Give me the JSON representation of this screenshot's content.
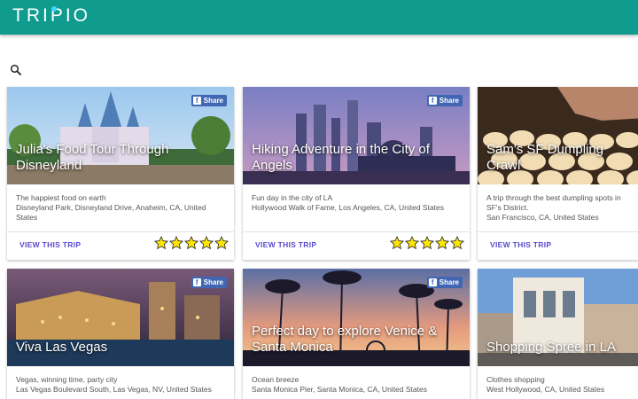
{
  "header": {
    "logo": "TRIPIO",
    "brand_color": "#0f9b8d"
  },
  "search": {
    "icon": "search-icon"
  },
  "share_label": "Share",
  "cards": [
    {
      "title": "Julia's Food Tour Through Disneyland",
      "description": "The happiest food on earth",
      "location": "Disneyland Park, Disneyland Drive, Anaheim, CA, United States",
      "link": "VIEW THIS TRIP",
      "rating": 5,
      "share": true
    },
    {
      "title": "Hiking Adventure in the City of Angels",
      "description": "Fun day in the city of LA",
      "location": "Hollywood Walk of Fame, Los Angeles, CA, United States",
      "link": "VIEW THIS TRIP",
      "rating": 5,
      "share": true
    },
    {
      "title": "Sam's SF Dumpling Crawl",
      "description": "A trip through the best dumpling spots in SF's District.",
      "location": "San Francisco, CA, United States",
      "link": "VIEW THIS TRIP",
      "rating": 0,
      "share": false
    },
    {
      "title": "Viva Las Vegas",
      "description": "Vegas, winning time, party city",
      "location": "Las Vegas Boulevard South, Las Vegas, NV, United States",
      "share": true
    },
    {
      "title": "Perfect day to explore Venice & Santa Monica",
      "description": "Ocean breeze",
      "location": "Santa Monica Pier, Santa Monica, CA, United States",
      "share": true
    },
    {
      "title": "Shopping Spree in LA",
      "description": "Clothes shopping",
      "location": "West Hollywood, CA, United States",
      "share": false
    }
  ]
}
